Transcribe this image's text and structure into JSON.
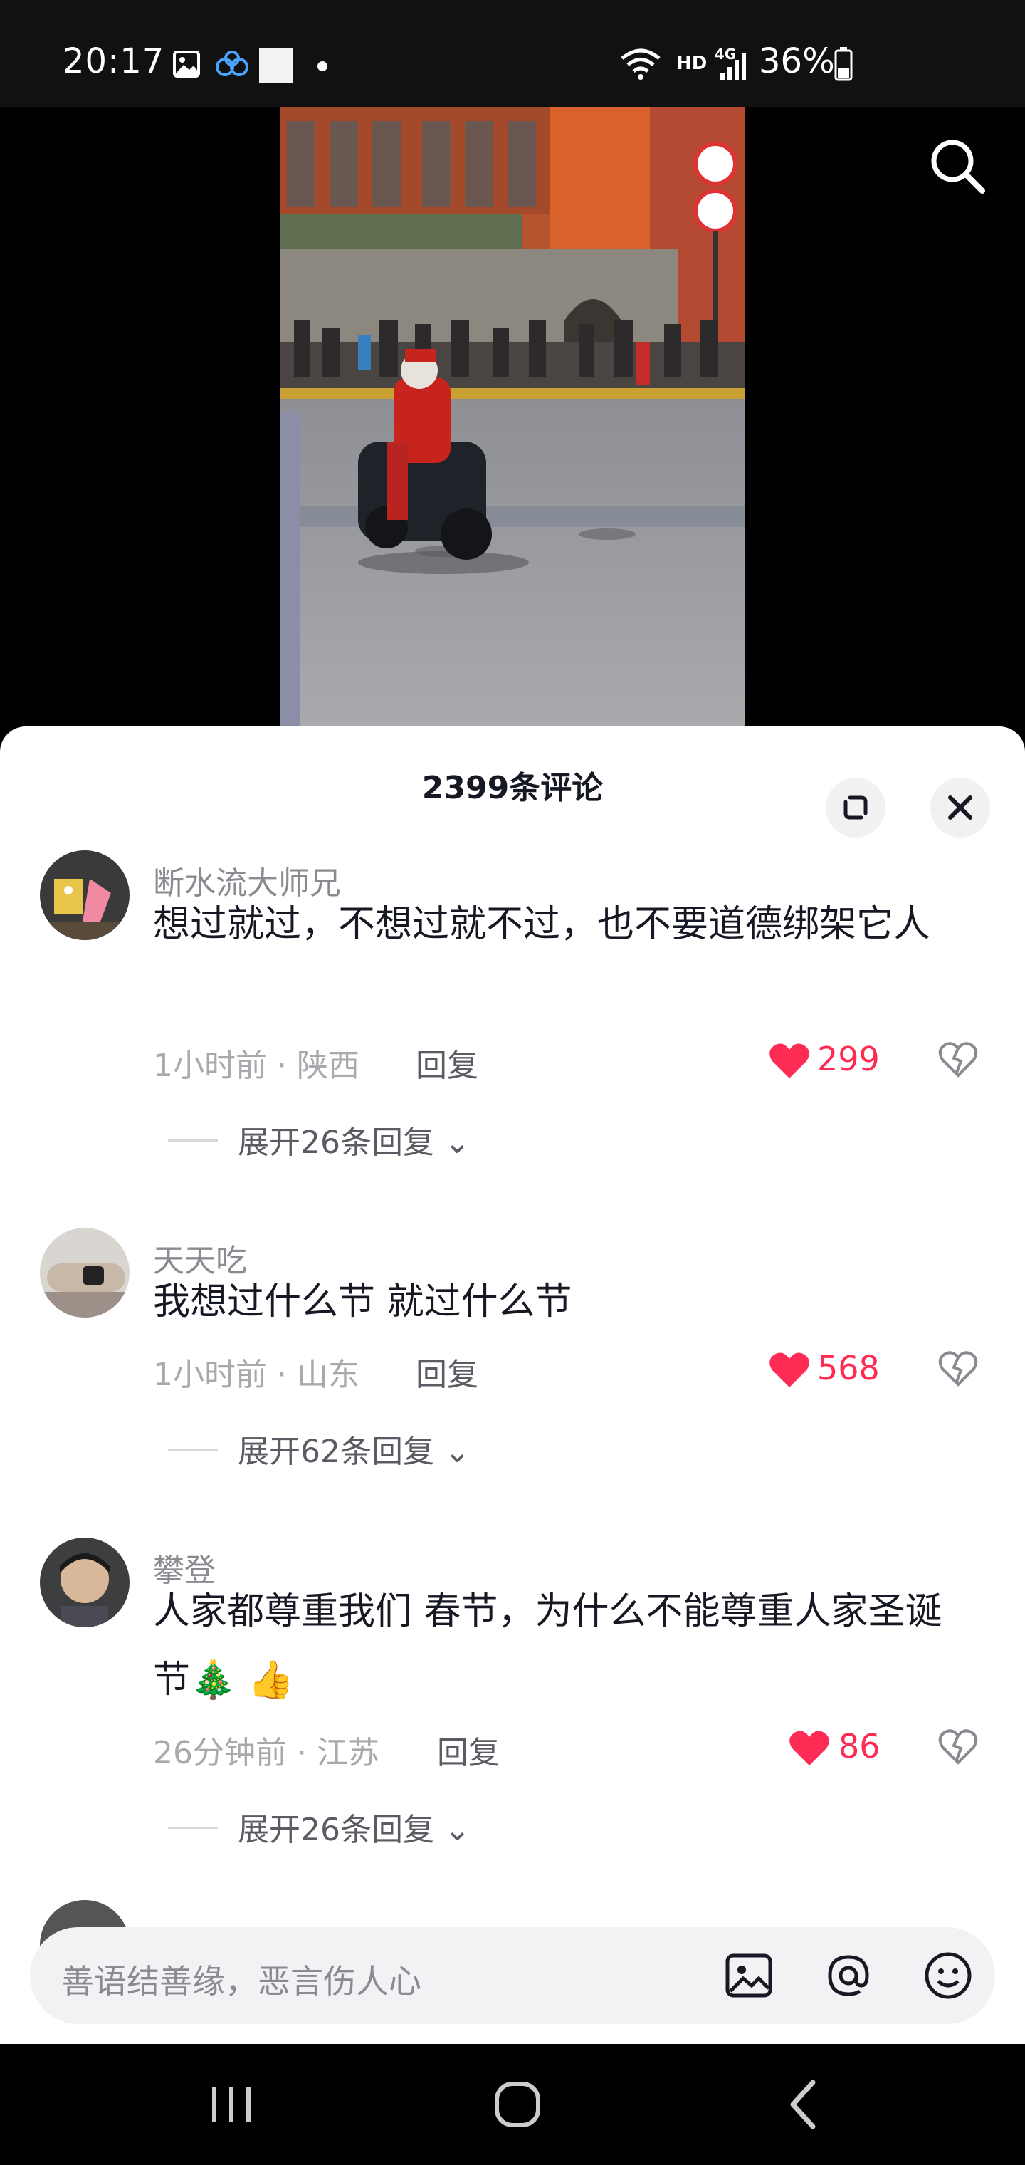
{
  "status_bar": {
    "time": "20:17",
    "network": "HD",
    "signal_label": "4G",
    "battery": "36%"
  },
  "video": {
    "search_icon": "search-icon"
  },
  "comments": {
    "title": "2399条评论",
    "items": [
      {
        "username": "断水流大师兄",
        "text": "想过就过，不想过就不过，也不要道德绑架它人",
        "time": "1小时前",
        "location": "陕西",
        "reply_label": "回复",
        "likes": "299",
        "expand_label": "展开26条回复"
      },
      {
        "username": "天天吃",
        "text": "我想过什么节 就过什么节",
        "time": "1小时前",
        "location": "山东",
        "reply_label": "回复",
        "likes": "568",
        "expand_label": "展开62条回复"
      },
      {
        "username": "攀登",
        "text": "人家都尊重我们 春节，为什么不能尊重人家圣诞节🎄 👍",
        "time": "26分钟前",
        "location": "江苏",
        "reply_label": "回复",
        "likes": "86",
        "expand_label": "展开26条回复"
      }
    ]
  },
  "input": {
    "placeholder": "善语结善缘，恶言伤人心"
  },
  "colors": {
    "accent": "#fe2c55",
    "text": "#161823",
    "muted": "#8a8b91"
  }
}
